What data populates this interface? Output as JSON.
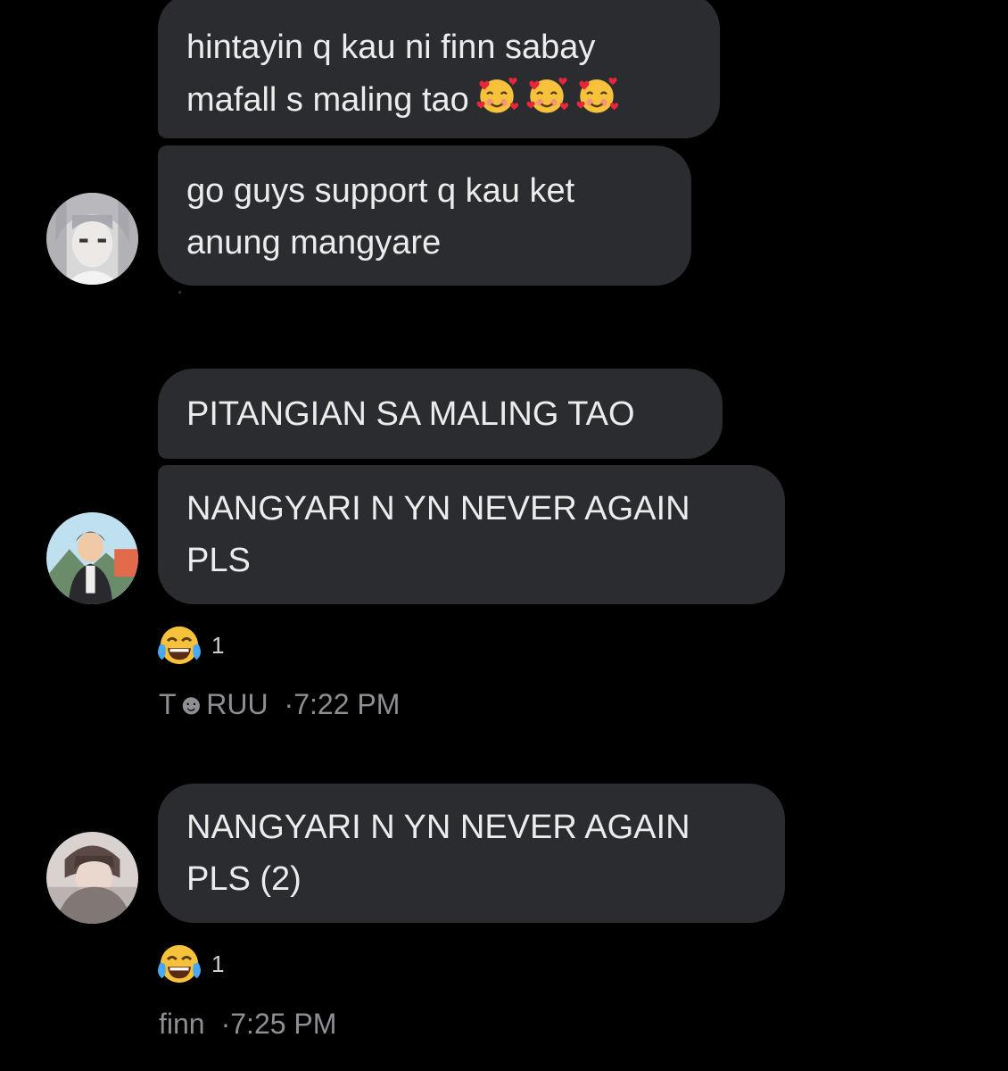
{
  "conversation": {
    "messages": [
      {
        "lines": [
          "hintayin q kau ni finn sabay",
          "mafall s maling tao"
        ],
        "emoji_icons": [
          "smiling-face-with-hearts-icon",
          "smiling-face-with-hearts-icon",
          "smiling-face-with-hearts-icon"
        ]
      },
      {
        "lines": [
          "go guys support q kau ket",
          "anung mangyare"
        ]
      },
      {
        "lines": [
          "PITANGIAN SA MALING TAO"
        ]
      },
      {
        "lines": [
          "NANGYARI N YN NEVER AGAIN",
          "PLS"
        ]
      },
      {
        "lines": [
          "NANGYARI N YN NEVER AGAIN",
          "PLS (2)"
        ]
      }
    ],
    "reactions": [
      {
        "icon": "face-with-tears-of-joy-icon",
        "count": "1"
      },
      {
        "icon": "face-with-tears-of-joy-icon",
        "count": "1"
      }
    ],
    "meta": [
      {
        "sender": "T☻RUU",
        "time": "·7:22 PM"
      },
      {
        "sender": "finn",
        "time": "·7:25 PM"
      }
    ]
  },
  "colors": {
    "background": "#000000",
    "bubble": "#2b2c30",
    "text": "#ececec",
    "meta_text": "#8e8e93"
  }
}
